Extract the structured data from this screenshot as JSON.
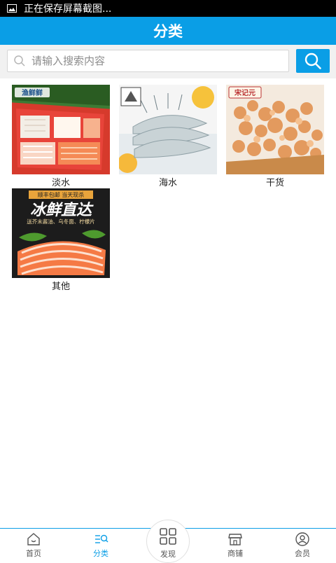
{
  "status_bar": {
    "text": "正在保存屏幕截图..."
  },
  "header": {
    "title": "分类"
  },
  "search": {
    "placeholder": "请输入搜索内容"
  },
  "categories": [
    {
      "label": "淡水",
      "image": "sashimi-platter-photo",
      "brand": "渔鲜鲜"
    },
    {
      "label": "海水",
      "image": "shrimp-on-ice-photo"
    },
    {
      "label": "干货",
      "image": "dried-shrimp-photo",
      "brand": "宋记元"
    },
    {
      "label": "其他",
      "image": "salmon-ad-photo",
      "ad_top": "顺丰包邮 当天现杀",
      "ad_title": "冰鲜直达",
      "ad_sub": "送芥末酱油、乌冬面、柠檬片"
    }
  ],
  "nav": {
    "items": [
      {
        "label": "首页",
        "icon": "home-icon"
      },
      {
        "label": "分类",
        "icon": "category-icon",
        "active": true
      },
      {
        "label": "发现",
        "icon": "grid-icon"
      },
      {
        "label": "商铺",
        "icon": "shop-icon"
      },
      {
        "label": "会员",
        "icon": "user-icon"
      }
    ]
  },
  "colors": {
    "accent": "#0a9ee6",
    "status_bar": "#000000"
  }
}
